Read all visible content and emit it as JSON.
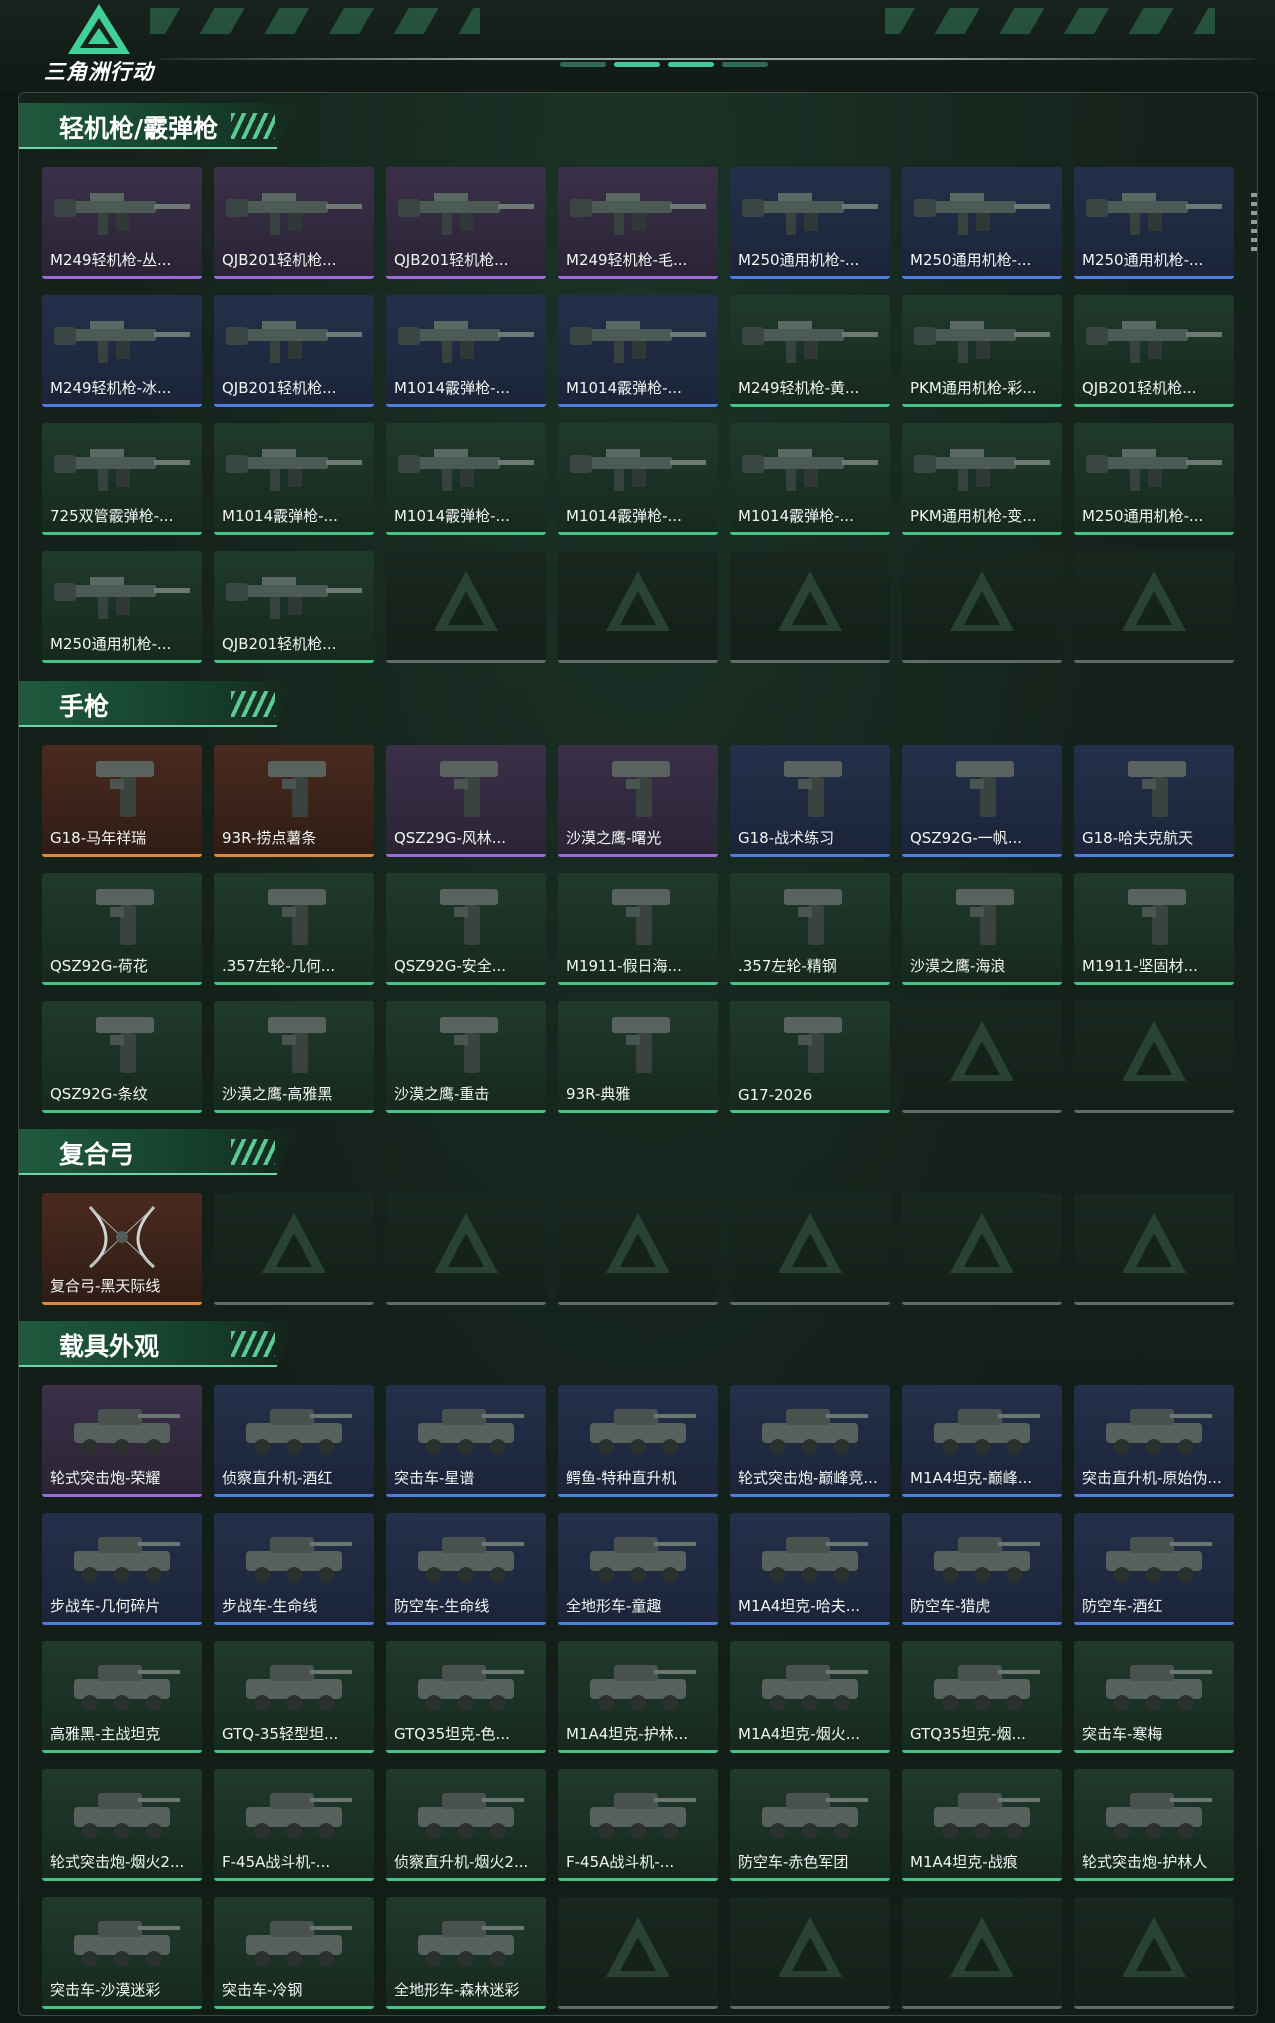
{
  "header": {
    "logo_text": "三角洲行动",
    "logo_icon": "triangle-logo-icon"
  },
  "colors": {
    "purple": "#9b6cd8",
    "blue": "#4d7ee0",
    "green": "#44c585",
    "orange": "#e08a3c",
    "empty": "#5f6b65",
    "accent": "#6fd3a3"
  },
  "sections": [
    {
      "title": "轻机枪/霰弹枪",
      "kind": "gun",
      "items": [
        {
          "label": "M249轻机枪-丛...",
          "rarity": "purple"
        },
        {
          "label": "QJB201轻机枪...",
          "rarity": "purple"
        },
        {
          "label": "QJB201轻机枪...",
          "rarity": "purple"
        },
        {
          "label": "M249轻机枪-毛...",
          "rarity": "purple"
        },
        {
          "label": "M250通用机枪-...",
          "rarity": "blue"
        },
        {
          "label": "M250通用机枪-...",
          "rarity": "blue"
        },
        {
          "label": "M250通用机枪-...",
          "rarity": "blue"
        },
        {
          "label": "M249轻机枪-冰...",
          "rarity": "blue"
        },
        {
          "label": "QJB201轻机枪...",
          "rarity": "blue"
        },
        {
          "label": "M1014霰弹枪-...",
          "rarity": "blue"
        },
        {
          "label": "M1014霰弹枪-...",
          "rarity": "blue"
        },
        {
          "label": "M249轻机枪-黄...",
          "rarity": "green"
        },
        {
          "label": "PKM通用机枪-彩...",
          "rarity": "green"
        },
        {
          "label": "QJB201轻机枪...",
          "rarity": "green"
        },
        {
          "label": "725双管霰弹枪-...",
          "rarity": "green"
        },
        {
          "label": "M1014霰弹枪-...",
          "rarity": "green"
        },
        {
          "label": "M1014霰弹枪-...",
          "rarity": "green"
        },
        {
          "label": "M1014霰弹枪-...",
          "rarity": "green"
        },
        {
          "label": "M1014霰弹枪-...",
          "rarity": "green"
        },
        {
          "label": "PKM通用机枪-变...",
          "rarity": "green"
        },
        {
          "label": "M250通用机枪-...",
          "rarity": "green"
        },
        {
          "label": "M250通用机枪-...",
          "rarity": "green"
        },
        {
          "label": "QJB201轻机枪...",
          "rarity": "green"
        },
        {
          "label": "",
          "rarity": "empty"
        },
        {
          "label": "",
          "rarity": "empty"
        },
        {
          "label": "",
          "rarity": "empty"
        },
        {
          "label": "",
          "rarity": "empty"
        },
        {
          "label": "",
          "rarity": "empty"
        }
      ]
    },
    {
      "title": "手枪",
      "kind": "pistol",
      "items": [
        {
          "label": "G18-马年祥瑞",
          "rarity": "orange"
        },
        {
          "label": "93R-捞点薯条",
          "rarity": "orange"
        },
        {
          "label": "QSZ29G-风林...",
          "rarity": "purple"
        },
        {
          "label": "沙漠之鹰-曙光",
          "rarity": "purple"
        },
        {
          "label": "G18-战术练习",
          "rarity": "blue"
        },
        {
          "label": "QSZ92G-一帆...",
          "rarity": "blue"
        },
        {
          "label": "G18-哈夫克航天",
          "rarity": "blue"
        },
        {
          "label": "QSZ92G-荷花",
          "rarity": "green"
        },
        {
          "label": ".357左轮-几何...",
          "rarity": "green"
        },
        {
          "label": "QSZ92G-安全...",
          "rarity": "green"
        },
        {
          "label": "M1911-假日海...",
          "rarity": "green"
        },
        {
          "label": ".357左轮-精钢",
          "rarity": "green"
        },
        {
          "label": "沙漠之鹰-海浪",
          "rarity": "green"
        },
        {
          "label": "M1911-坚固材...",
          "rarity": "green"
        },
        {
          "label": "QSZ92G-条纹",
          "rarity": "green"
        },
        {
          "label": "沙漠之鹰-高雅黑",
          "rarity": "green"
        },
        {
          "label": "沙漠之鹰-重击",
          "rarity": "green"
        },
        {
          "label": "93R-典雅",
          "rarity": "green"
        },
        {
          "label": "G17-2026",
          "rarity": "green"
        },
        {
          "label": "",
          "rarity": "empty"
        },
        {
          "label": "",
          "rarity": "empty"
        }
      ]
    },
    {
      "title": "复合弓",
      "kind": "bow",
      "items": [
        {
          "label": "复合弓-黑天际线",
          "rarity": "orange"
        },
        {
          "label": "",
          "rarity": "empty"
        },
        {
          "label": "",
          "rarity": "empty"
        },
        {
          "label": "",
          "rarity": "empty"
        },
        {
          "label": "",
          "rarity": "empty"
        },
        {
          "label": "",
          "rarity": "empty"
        },
        {
          "label": "",
          "rarity": "empty"
        }
      ]
    },
    {
      "title": "载具外观",
      "kind": "vehicle",
      "items": [
        {
          "label": "轮式突击炮-荣耀",
          "rarity": "purple"
        },
        {
          "label": "侦察直升机-酒红",
          "rarity": "blue"
        },
        {
          "label": "突击车-星谱",
          "rarity": "blue"
        },
        {
          "label": "鳄鱼-特种直升机",
          "rarity": "blue"
        },
        {
          "label": "轮式突击炮-巅峰竞...",
          "rarity": "blue"
        },
        {
          "label": "M1A4坦克-巅峰...",
          "rarity": "blue"
        },
        {
          "label": "突击直升机-原始伪...",
          "rarity": "blue"
        },
        {
          "label": "步战车-几何碎片",
          "rarity": "blue"
        },
        {
          "label": "步战车-生命线",
          "rarity": "blue"
        },
        {
          "label": "防空车-生命线",
          "rarity": "blue"
        },
        {
          "label": "全地形车-童趣",
          "rarity": "blue"
        },
        {
          "label": "M1A4坦克-哈夫...",
          "rarity": "blue"
        },
        {
          "label": "防空车-猎虎",
          "rarity": "blue"
        },
        {
          "label": "防空车-酒红",
          "rarity": "blue"
        },
        {
          "label": "高雅黑-主战坦克",
          "rarity": "green"
        },
        {
          "label": "GTQ-35轻型坦...",
          "rarity": "green"
        },
        {
          "label": "GTQ35坦克-色...",
          "rarity": "green"
        },
        {
          "label": "M1A4坦克-护林...",
          "rarity": "green"
        },
        {
          "label": "M1A4坦克-烟火...",
          "rarity": "green"
        },
        {
          "label": "GTQ35坦克-烟...",
          "rarity": "green"
        },
        {
          "label": "突击车-寒梅",
          "rarity": "green"
        },
        {
          "label": "轮式突击炮-烟火2...",
          "rarity": "green"
        },
        {
          "label": "F-45A战斗机-...",
          "rarity": "green"
        },
        {
          "label": "侦察直升机-烟火2...",
          "rarity": "green"
        },
        {
          "label": "F-45A战斗机-...",
          "rarity": "green"
        },
        {
          "label": "防空车-赤色军团",
          "rarity": "green"
        },
        {
          "label": "M1A4坦克-战痕",
          "rarity": "green"
        },
        {
          "label": "轮式突击炮-护林人",
          "rarity": "green"
        },
        {
          "label": "突击车-沙漠迷彩",
          "rarity": "green"
        },
        {
          "label": "突击车-冷钢",
          "rarity": "green"
        },
        {
          "label": "全地形车-森林迷彩",
          "rarity": "green"
        },
        {
          "label": "",
          "rarity": "empty"
        },
        {
          "label": "",
          "rarity": "empty"
        },
        {
          "label": "",
          "rarity": "empty"
        },
        {
          "label": "",
          "rarity": "empty"
        }
      ]
    }
  ]
}
